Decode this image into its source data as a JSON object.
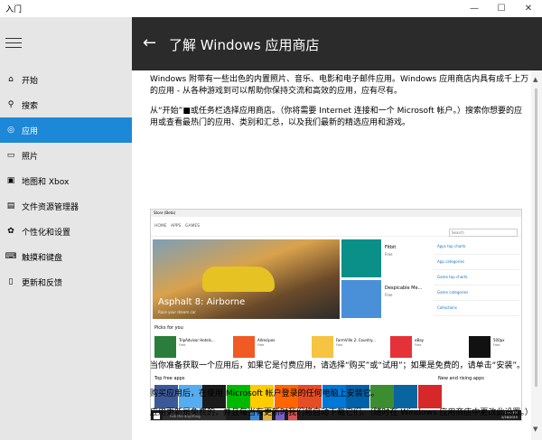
{
  "window": {
    "title": "入门",
    "minimize": "—",
    "maximize": "☐",
    "close": "✕"
  },
  "sidebar": {
    "items": [
      {
        "label": "开始",
        "icon": "home-icon",
        "glyph": "⌂"
      },
      {
        "label": "搜索",
        "icon": "search-icon",
        "glyph": "⚲"
      },
      {
        "label": "应用",
        "icon": "apps-icon",
        "glyph": "◎"
      },
      {
        "label": "照片",
        "icon": "photos-icon",
        "glyph": "▭"
      },
      {
        "label": "地图和 Xbox",
        "icon": "maps-xbox-icon",
        "glyph": "▣"
      },
      {
        "label": "文件资源管理器",
        "icon": "file-explorer-icon",
        "glyph": "▤"
      },
      {
        "label": "个性化和设置",
        "icon": "palette-icon",
        "glyph": "✿"
      },
      {
        "label": "触摸和键盘",
        "icon": "keyboard-icon",
        "glyph": "⌨"
      },
      {
        "label": "更新和反馈",
        "icon": "feedback-icon",
        "glyph": "▯"
      }
    ],
    "active_index": 2
  },
  "header": {
    "back_glyph": "←",
    "title": "了解 Windows 应用商店"
  },
  "content": {
    "p1": "Windows 附带有一些出色的内置照片、音乐、电影和电子邮件应用。Windows 应用商店内具有成千上万的应用 - 从各种游戏到可以帮助你保持交流和高效的应用，应有尽有。",
    "p2": "从“开始”■或任务栏选择应用商店。（你将需要 Internet 连接和一个 Microsoft 帐户。）搜索你想要的应用或查看最热门的应用、类别和汇总，以及我们最新的精选应用和游戏。",
    "p3": "当你准备获取一个应用后，如果它是付费应用，请选择“购买”或“试用”；如果是免费的，请单击“安装”。",
    "p4": "购买应用后，在使用 Microsoft 帐户登录的任何电脑上安装它。",
    "p5": "应用更新是免费的，并且每当有更新时我们将自动下载它们。（随时在 Windows 应用商店中更改此设置。）"
  },
  "store_shot": {
    "window_title": "Store (Beta)",
    "tabs": [
      "HOME",
      "APPS",
      "GAMES"
    ],
    "search_placeholder": "Search",
    "hero_title": "Asphalt 8: Airborne",
    "hero_sub": "Race your dream car",
    "tiles": [
      {
        "name": "Fitbit",
        "sub": "Free"
      },
      {
        "name": "Despicable Me...",
        "sub": "Free"
      }
    ],
    "side_links": [
      "Apps top charts",
      "App categories",
      "Game top charts",
      "Game categories",
      "Collections"
    ],
    "picks_title": "Picks for you",
    "picks": [
      {
        "name": "TripAdvisor Hotels...",
        "price": "Free"
      },
      {
        "name": "Allrecipes",
        "price": "Free"
      },
      {
        "name": "FarmVille 2: Country...",
        "price": "Free"
      },
      {
        "name": "eBay",
        "price": "Free"
      },
      {
        "name": "500px",
        "price": "Free"
      }
    ],
    "free_title": "Top free apps",
    "new_title": "New and rising apps",
    "taskbar_search": "Ask me anything",
    "clock_time": "1:37 PM",
    "clock_date": "2/16/2015"
  },
  "colors": {
    "accent": "#1e88d8",
    "header_bg": "#2b2b2b",
    "sidebar_bg": "#e6e6e6"
  }
}
